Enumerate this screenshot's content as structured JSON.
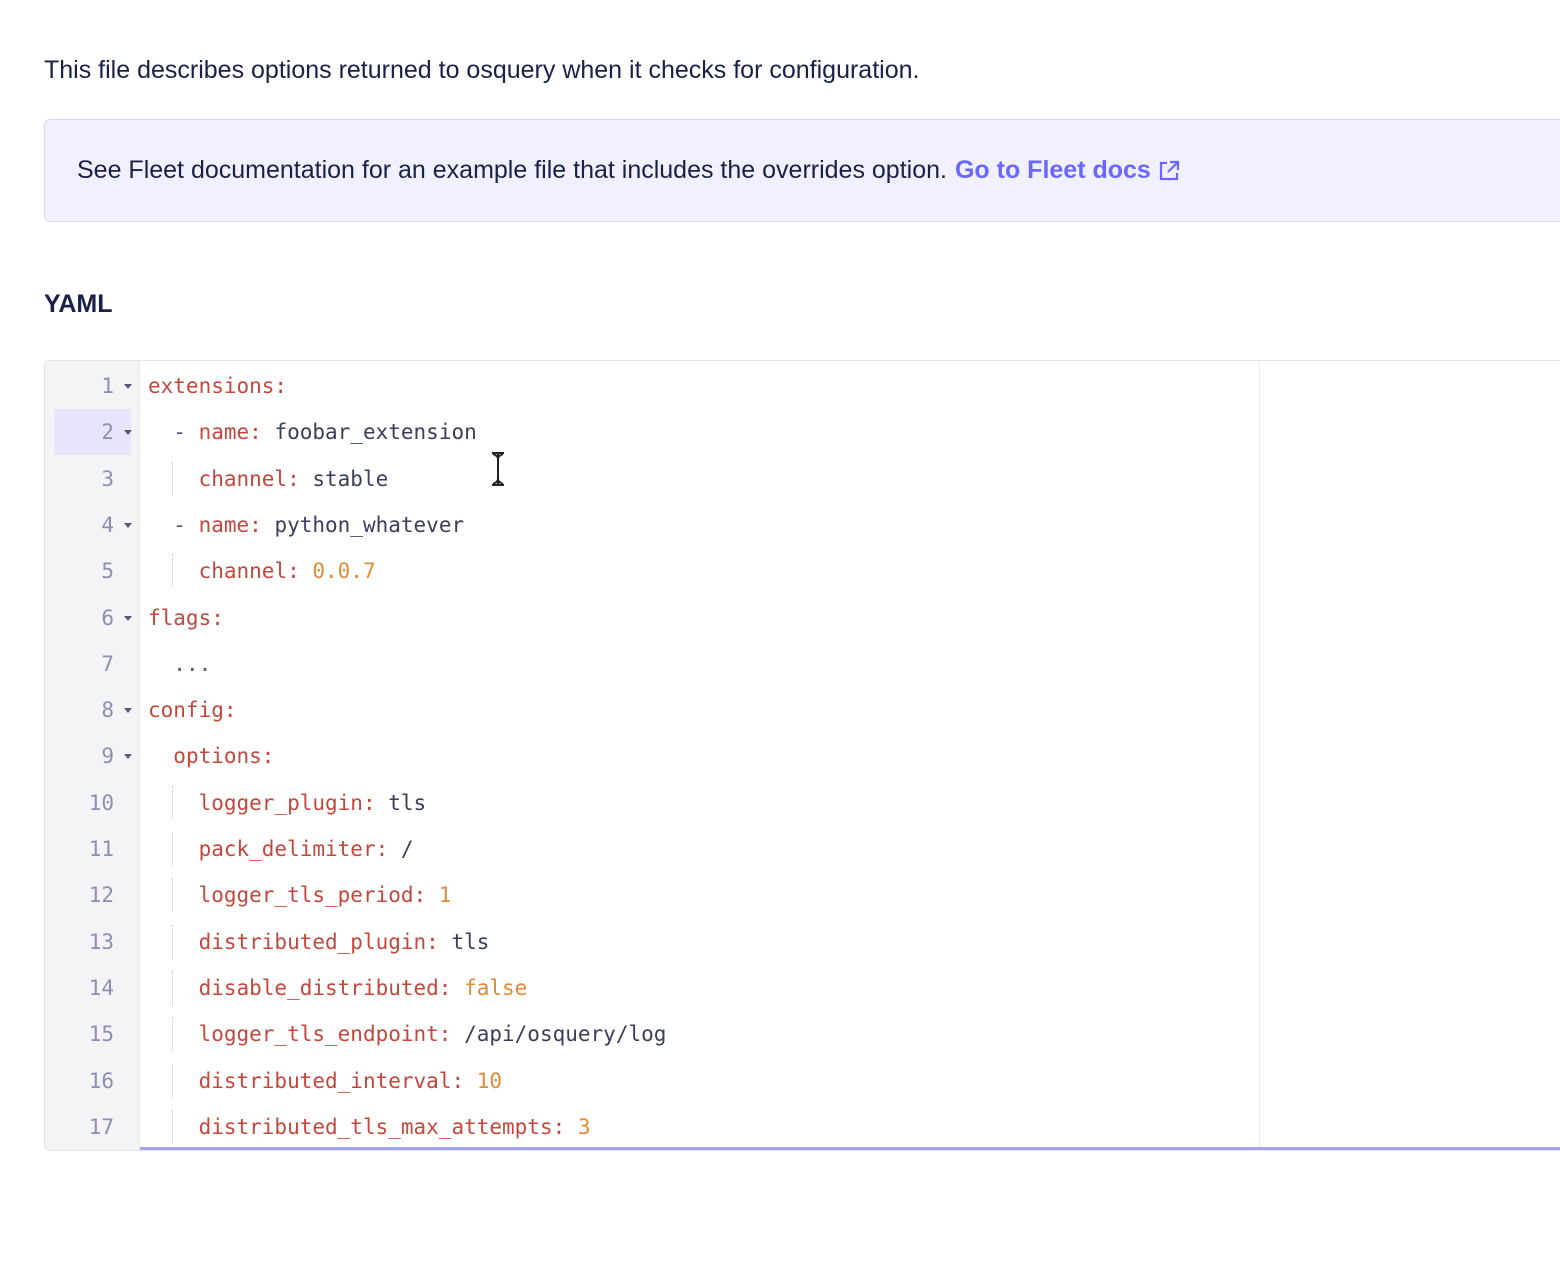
{
  "intro_text": "This file describes options returned to osquery when it checks for configuration.",
  "banner": {
    "text": "See Fleet documentation for an example file that includes the overrides option.",
    "link_label": "Go to Fleet docs",
    "link_icon": "external-link-icon"
  },
  "section_label": "YAML",
  "editor": {
    "active_line": 2,
    "lines": [
      {
        "num": "1",
        "fold": true,
        "indent": 0,
        "guide": false,
        "dash": false,
        "key": "extensions:",
        "value": ""
      },
      {
        "num": "2",
        "fold": true,
        "indent": 1,
        "guide": false,
        "dash": true,
        "key": "name:",
        "value": " foobar_extension"
      },
      {
        "num": "3",
        "fold": false,
        "indent": 2,
        "guide": true,
        "dash": false,
        "key": "channel:",
        "value": " stable"
      },
      {
        "num": "4",
        "fold": true,
        "indent": 1,
        "guide": false,
        "dash": true,
        "key": "name:",
        "value": " python_whatever"
      },
      {
        "num": "5",
        "fold": false,
        "indent": 2,
        "guide": true,
        "dash": false,
        "key": "channel:",
        "value": " 0.0.7",
        "value_type": "number"
      },
      {
        "num": "6",
        "fold": true,
        "indent": 0,
        "guide": false,
        "dash": false,
        "key": "flags:",
        "value": ""
      },
      {
        "num": "7",
        "fold": false,
        "indent": 1,
        "guide": false,
        "dash": false,
        "key": "",
        "value": "...",
        "value_type": "plain"
      },
      {
        "num": "8",
        "fold": true,
        "indent": 0,
        "guide": false,
        "dash": false,
        "key": "config:",
        "value": ""
      },
      {
        "num": "9",
        "fold": true,
        "indent": 1,
        "guide": false,
        "dash": false,
        "key": "options:",
        "value": ""
      },
      {
        "num": "10",
        "fold": false,
        "indent": 2,
        "guide": true,
        "dash": false,
        "key": "logger_plugin:",
        "value": " tls"
      },
      {
        "num": "11",
        "fold": false,
        "indent": 2,
        "guide": true,
        "dash": false,
        "key": "pack_delimiter:",
        "value": " /"
      },
      {
        "num": "12",
        "fold": false,
        "indent": 2,
        "guide": true,
        "dash": false,
        "key": "logger_tls_period:",
        "value": " 1",
        "value_type": "number"
      },
      {
        "num": "13",
        "fold": false,
        "indent": 2,
        "guide": true,
        "dash": false,
        "key": "distributed_plugin:",
        "value": " tls"
      },
      {
        "num": "14",
        "fold": false,
        "indent": 2,
        "guide": true,
        "dash": false,
        "key": "disable_distributed:",
        "value": " false",
        "value_type": "number"
      },
      {
        "num": "15",
        "fold": false,
        "indent": 2,
        "guide": true,
        "dash": false,
        "key": "logger_tls_endpoint:",
        "value": " /api/osquery/log"
      },
      {
        "num": "16",
        "fold": false,
        "indent": 2,
        "guide": true,
        "dash": false,
        "key": "distributed_interval:",
        "value": " 10",
        "value_type": "number"
      },
      {
        "num": "17",
        "fold": false,
        "indent": 2,
        "guide": true,
        "dash": false,
        "key": "distributed_tls_max_attempts:",
        "value": " 3",
        "value_type": "number"
      }
    ]
  },
  "colors": {
    "key": "#c2483d",
    "number": "#e08b3a",
    "link": "#6a67fe",
    "banner_bg": "#f1f0ff"
  }
}
